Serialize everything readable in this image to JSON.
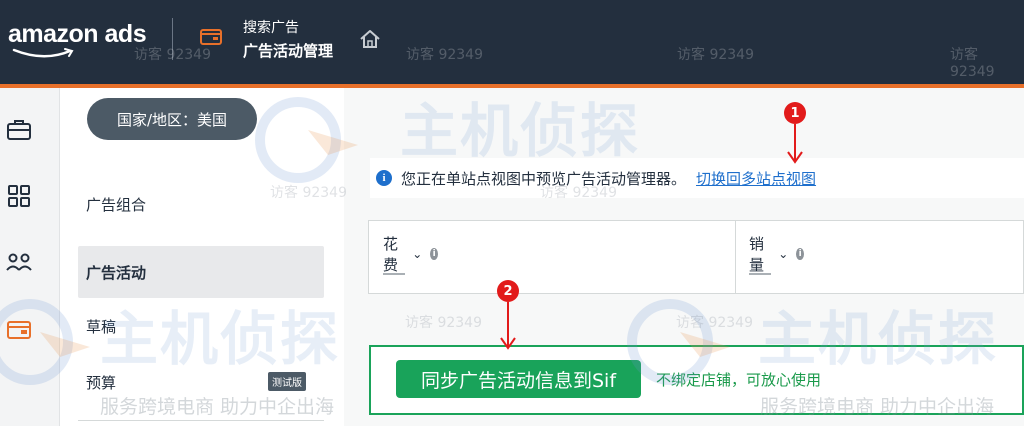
{
  "brand": {
    "logo_text": "amazon ads"
  },
  "header": {
    "breadcrumb_parent": "搜索广告",
    "breadcrumb_current": "广告活动管理",
    "icons": [
      "wallet-icon",
      "home-icon"
    ]
  },
  "left_rail": {
    "icons": [
      "briefcase-icon",
      "grid-icon",
      "users-icon",
      "wallet-icon"
    ]
  },
  "country_selector": {
    "label": "国家/地区：美国"
  },
  "sidebar": {
    "items": [
      {
        "label": "广告组合",
        "active": false
      },
      {
        "label": "广告活动",
        "active": true
      },
      {
        "label": "草稿",
        "active": false
      },
      {
        "label": "预算",
        "active": false,
        "badge": "测试版"
      }
    ]
  },
  "info_bar": {
    "message": "您正在单站点视图中预览广告活动管理器。",
    "link": "切换回多站点视图"
  },
  "metrics": [
    {
      "label": "花费",
      "value": "—"
    },
    {
      "label": "销量",
      "value": "—"
    }
  ],
  "sync": {
    "button": "同步广告活动信息到Sif",
    "note": "不绑定店铺，可放心使用"
  },
  "callouts": [
    "1",
    "2"
  ],
  "watermark": {
    "title": "主机侦探",
    "slogan": "服务跨境电商 助力中企出海",
    "visitor": "访客 92349"
  },
  "colors": {
    "header_bg": "#232f3e",
    "accent_orange": "#e8702a",
    "link_blue": "#1e6fcc",
    "sync_green": "#19a35a",
    "callout_red": "#e21b1b"
  }
}
